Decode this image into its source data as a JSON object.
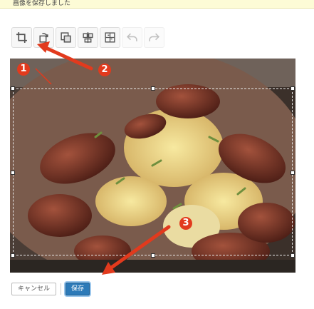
{
  "notice": {
    "text": "画像を保存しました"
  },
  "toolbar": {
    "buttons": [
      {
        "name": "crop-icon",
        "disabled": false
      },
      {
        "name": "rotate-icon",
        "disabled": false
      },
      {
        "name": "flip-vertical-icon",
        "disabled": false
      },
      {
        "name": "flip-horizontal-icon",
        "disabled": false
      },
      {
        "name": "scale-icon",
        "disabled": false
      },
      {
        "name": "undo-icon",
        "disabled": true
      },
      {
        "name": "redo-icon",
        "disabled": true
      }
    ]
  },
  "callouts": {
    "one": "1",
    "two": "2",
    "three": "3"
  },
  "actions": {
    "cancel_label": "キャンセル",
    "save_label": "保存"
  },
  "colors": {
    "callout": "#e23a1d",
    "save": "#2d7ab8"
  }
}
